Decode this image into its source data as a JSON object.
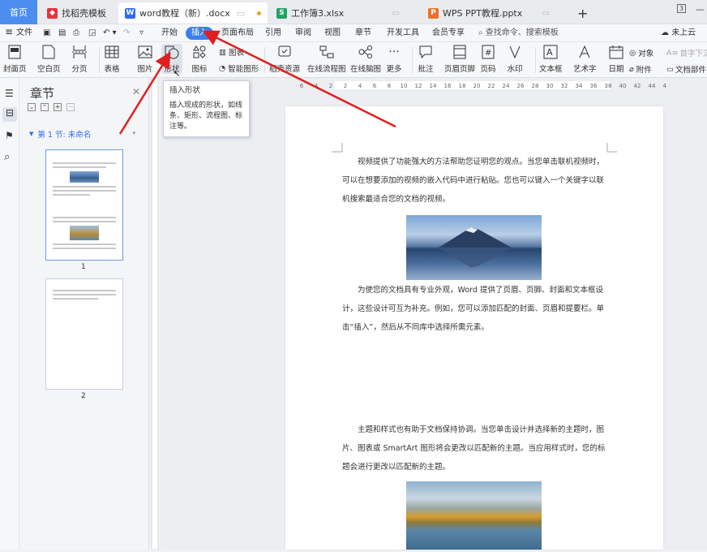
{
  "tabs": {
    "home": "首页",
    "t1": "找稻壳模板",
    "t2": "word教程（新）.docx",
    "t3": "工作簿3.xlsx",
    "t4": "WPS PPT教程.pptx",
    "plus": "+"
  },
  "menu": {
    "file": "文件",
    "items": [
      "开始",
      "插入",
      "页面布局",
      "引用",
      "审阅",
      "视图",
      "章节",
      "开发工具",
      "会员专享"
    ],
    "search": "查找命令、搜索模板",
    "cloud": "未上云"
  },
  "ribbon": {
    "cover": "封面页",
    "blank": "空白页",
    "pagebreak": "分页",
    "table": "表格",
    "picture": "图片",
    "shape": "形状",
    "icons": "图标",
    "chart": "图表",
    "smartart": "智能图形",
    "resources": "稻壳资源",
    "flowchart": "在线流程图",
    "mindmap": "在线脑图",
    "more": "更多",
    "comment": "批注",
    "header": "页眉页脚",
    "pagenum": "页码",
    "watermark": "水印",
    "textbox": "文本框",
    "wordart": "艺术字",
    "date": "日期",
    "object": "对象",
    "attachment": "附件",
    "dropcap": "首字下沉",
    "docpart": "文档部件"
  },
  "tooltip": {
    "title": "插入形状",
    "body": "插入现成的形状，如线条、矩形、流程图、标注等。"
  },
  "sidebar": {
    "title": "章节",
    "section": "第 1 节: 未命名",
    "page1": "1",
    "page2": "2"
  },
  "ruler": [
    "6",
    "4",
    "2",
    "2",
    "4",
    "6",
    "8",
    "10",
    "12",
    "14",
    "16",
    "18",
    "20",
    "22",
    "24",
    "26",
    "28",
    "30",
    "32",
    "34",
    "36",
    "38",
    "40",
    "42",
    "44",
    "46"
  ],
  "doc": {
    "p1": "视频提供了功能强大的方法帮助您证明您的观点。当您单击联机视频时，可以在想要添加的视频的嵌入代码中进行粘贴。您也可以键入一个关键字以联机搜索最适合您的文档的视频。",
    "p2": "为使您的文档具有专业外观，Word 提供了页眉、页脚、封面和文本框设计，这些设计可互为补充。例如，您可以添加匹配的封面、页眉和提要栏。单击“插入”，然后从不同库中选择所需元素。",
    "p3": "主题和样式也有助于文档保持协调。当您单击设计并选择新的主题时，图片、图表或 SmartArt 图形将会更改以匹配新的主题。当应用样式时，您的标题会进行更改以匹配新的主题。"
  },
  "colors": {
    "accent": "#3b7df2",
    "annotation": "#e02020"
  }
}
